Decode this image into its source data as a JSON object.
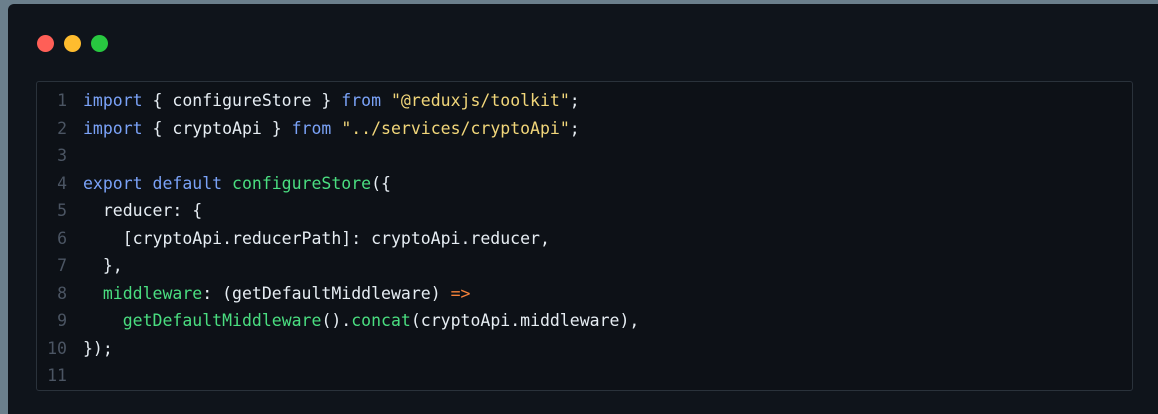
{
  "window": {
    "controls": {
      "close_color": "#ff5f57",
      "minimize_color": "#febc2e",
      "maximize_color": "#28c840"
    }
  },
  "editor": {
    "lines": [
      {
        "number": "1",
        "tokens": [
          {
            "t": "import",
            "c": "kw"
          },
          {
            "t": " { configureStore } ",
            "c": "plain"
          },
          {
            "t": "from",
            "c": "kw"
          },
          {
            "t": " ",
            "c": "plain"
          },
          {
            "t": "\"@reduxjs/toolkit\"",
            "c": "str"
          },
          {
            "t": ";",
            "c": "plain"
          }
        ]
      },
      {
        "number": "2",
        "tokens": [
          {
            "t": "import",
            "c": "kw"
          },
          {
            "t": " { cryptoApi } ",
            "c": "plain"
          },
          {
            "t": "from",
            "c": "kw"
          },
          {
            "t": " ",
            "c": "plain"
          },
          {
            "t": "\"../services/cryptoApi\"",
            "c": "str"
          },
          {
            "t": ";",
            "c": "plain"
          }
        ]
      },
      {
        "number": "3",
        "tokens": []
      },
      {
        "number": "4",
        "tokens": [
          {
            "t": "export default ",
            "c": "kw"
          },
          {
            "t": "configureStore",
            "c": "fn"
          },
          {
            "t": "({",
            "c": "plain"
          }
        ]
      },
      {
        "number": "5",
        "tokens": [
          {
            "t": "  reducer: {",
            "c": "plain"
          }
        ]
      },
      {
        "number": "6",
        "tokens": [
          {
            "t": "    [cryptoApi.reducerPath]: cryptoApi.reducer,",
            "c": "plain"
          }
        ]
      },
      {
        "number": "7",
        "tokens": [
          {
            "t": "  },",
            "c": "plain"
          }
        ]
      },
      {
        "number": "8",
        "tokens": [
          {
            "t": "  ",
            "c": "plain"
          },
          {
            "t": "middleware",
            "c": "fn"
          },
          {
            "t": ": (getDefaultMiddleware) ",
            "c": "plain"
          },
          {
            "t": "=>",
            "c": "arrow"
          }
        ]
      },
      {
        "number": "9",
        "tokens": [
          {
            "t": "    ",
            "c": "plain"
          },
          {
            "t": "getDefaultMiddleware",
            "c": "fn"
          },
          {
            "t": "().",
            "c": "plain"
          },
          {
            "t": "concat",
            "c": "fn"
          },
          {
            "t": "(cryptoApi.middleware),",
            "c": "plain"
          }
        ]
      },
      {
        "number": "10",
        "tokens": [
          {
            "t": "});",
            "c": "plain"
          }
        ]
      },
      {
        "number": "11",
        "tokens": []
      }
    ]
  }
}
